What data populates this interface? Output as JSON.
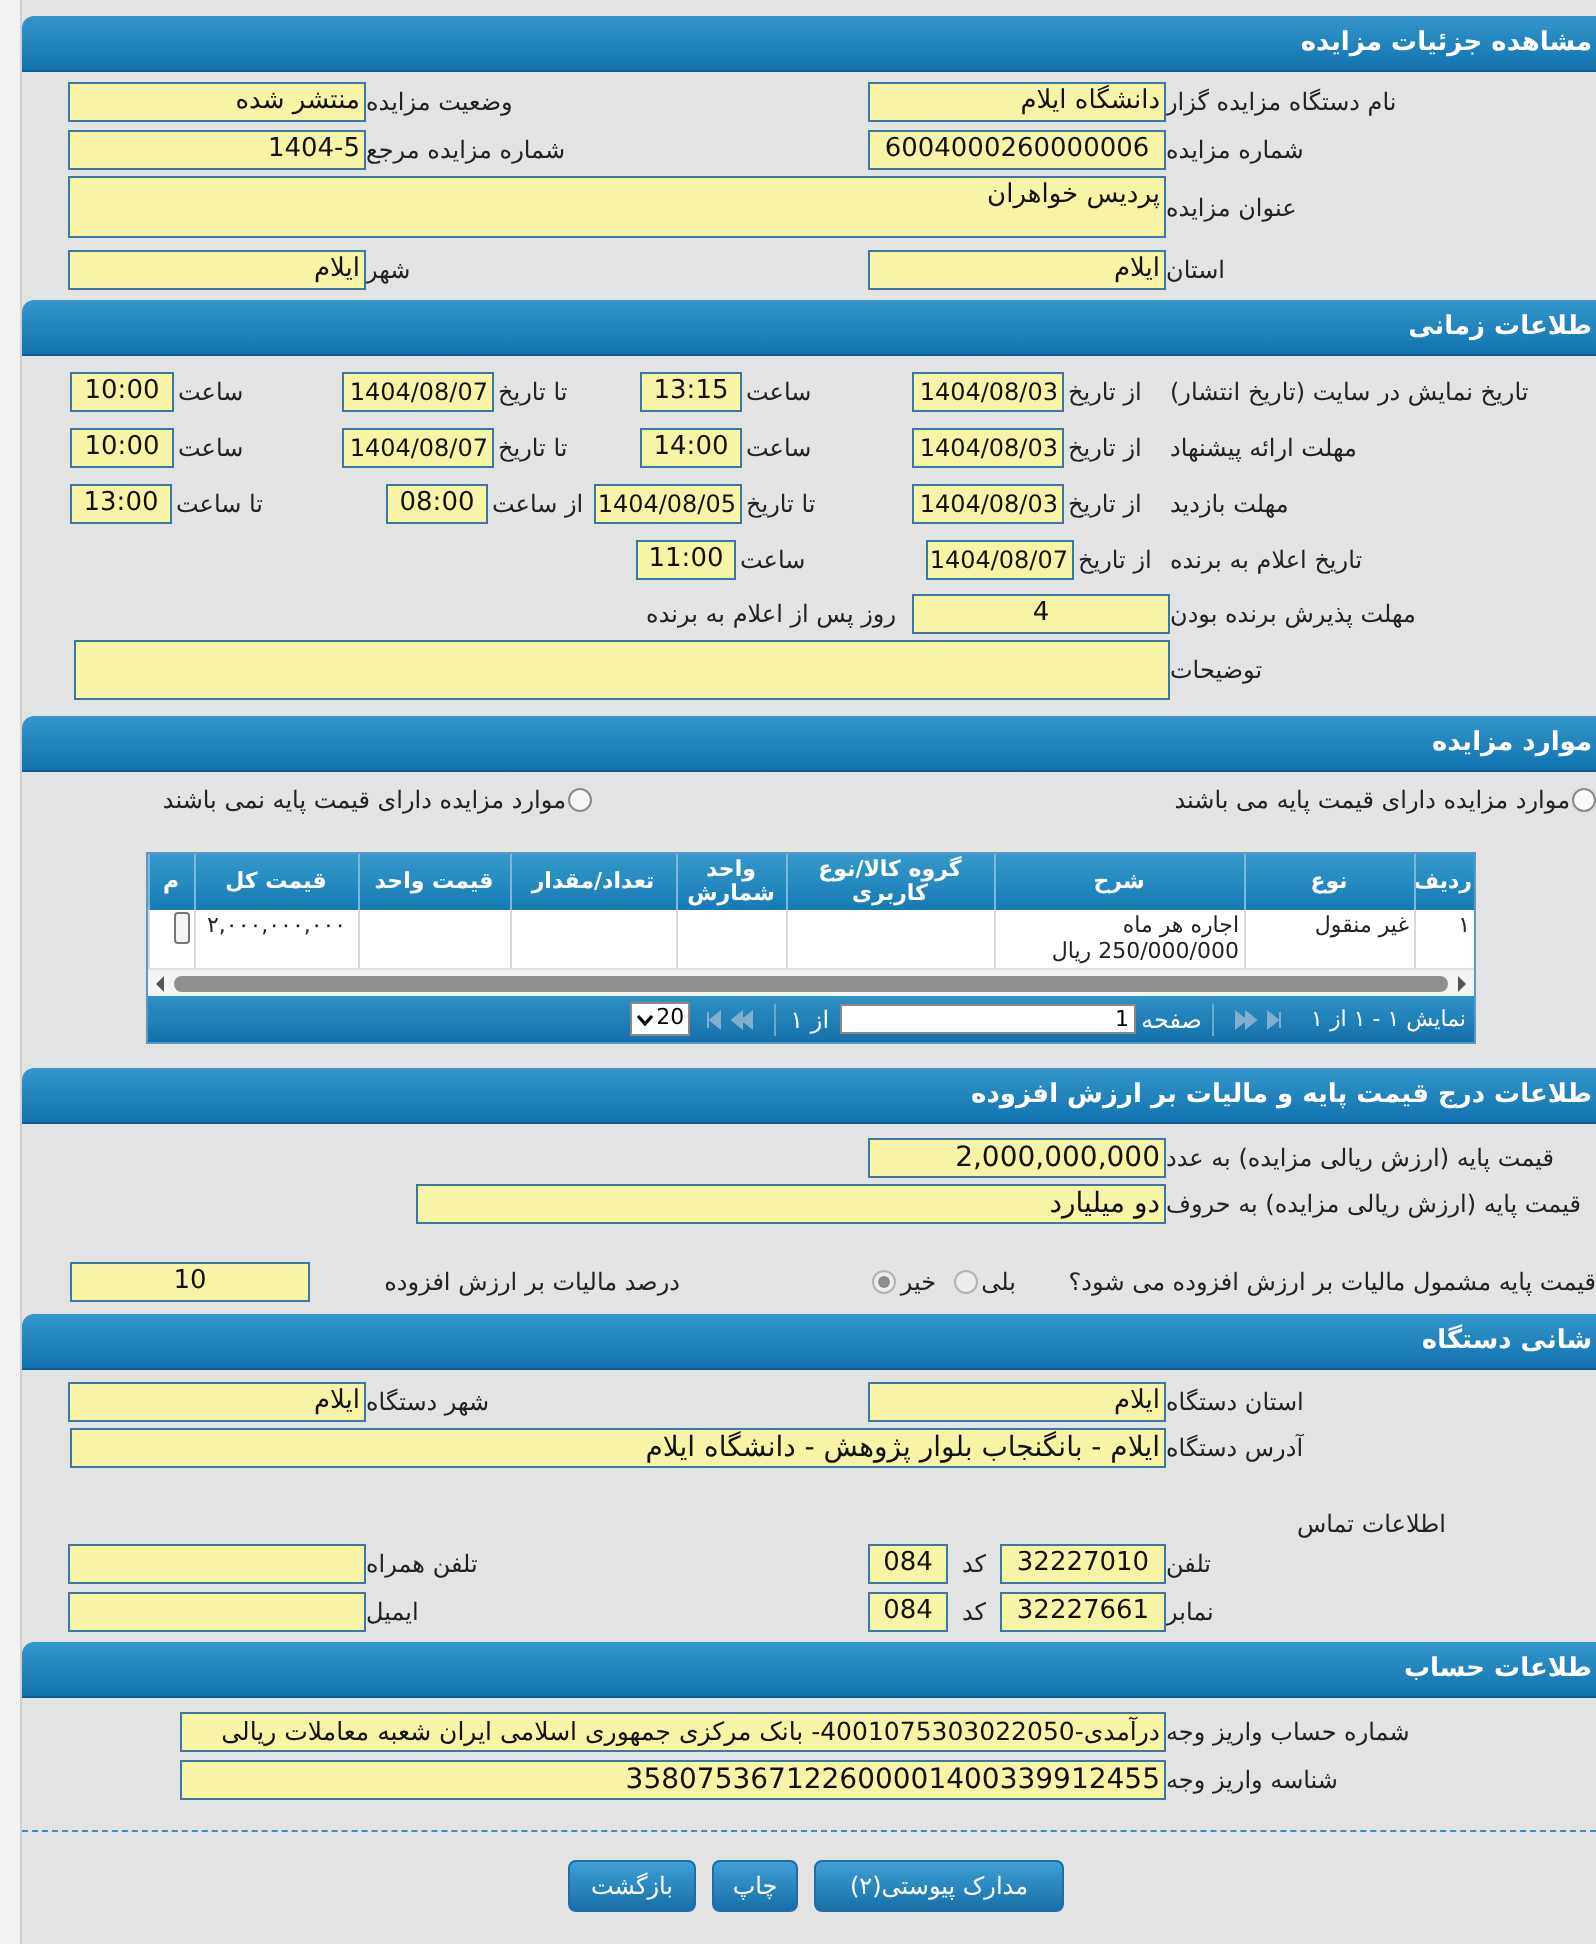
{
  "details": {
    "title": "مشاهده جزئیات مزایده",
    "fields": [
      {
        "label": "نام دستگاه مزایده گزار",
        "value": "دانشگاه ایلام"
      },
      {
        "label": "وضعیت مزایده",
        "value": "منتشر شده"
      },
      {
        "label": "شماره مزایده",
        "value": "6004000260000006"
      },
      {
        "label": "شماره مزایده مرجع",
        "value": "1404-5"
      },
      {
        "label": "عنوان مزایده",
        "value": "پردیس خواهران"
      },
      {
        "label": "استان",
        "value": "ایلام"
      },
      {
        "label": "شهر",
        "value": "ایلام"
      }
    ]
  },
  "timing": {
    "title": "طلاعات زمانی",
    "rows": [
      {
        "label": "تاریخ نمایش در سایت (تاریخ انتشار)",
        "parts": [
          {
            "label": "از تاریخ",
            "value": "1404/08/03"
          },
          {
            "label": "ساعت",
            "value": "13:15"
          },
          {
            "label": "تا تاریخ",
            "value": "1404/08/07"
          },
          {
            "label": "ساعت",
            "value": "10:00"
          }
        ]
      },
      {
        "label": "مهلت ارائه پیشنهاد",
        "parts": [
          {
            "label": "از تاریخ",
            "value": "1404/08/03"
          },
          {
            "label": "ساعت",
            "value": "14:00"
          },
          {
            "label": "تا تاریخ",
            "value": "1404/08/07"
          },
          {
            "label": "ساعت",
            "value": "10:00"
          }
        ]
      },
      {
        "label": "مهلت بازدید",
        "parts": [
          {
            "label": "از تاریخ",
            "value": "1404/08/03"
          },
          {
            "label": "تا تاریخ",
            "value": "1404/08/05"
          },
          {
            "label": "از ساعت",
            "value": "08:00"
          },
          {
            "label": "تا ساعت",
            "value": "13:00"
          }
        ]
      },
      {
        "label": "تاریخ اعلام به برنده",
        "parts": [
          {
            "label": "از تاریخ",
            "value": "1404/08/07"
          },
          {
            "label": "ساعت",
            "value": "11:00"
          }
        ]
      }
    ],
    "acceptance": {
      "label": "مهلت پذیرش برنده بودن",
      "value": "4",
      "suffix": "روز پس از اعلام به برنده"
    },
    "notes_label": "توضیحات"
  },
  "items": {
    "title": "موارد مزایده",
    "options": [
      {
        "label": "موارد مزایده دارای قیمت پایه می باشند",
        "selected": false
      },
      {
        "label": "موارد مزایده دارای قیمت پایه نمی باشند",
        "selected": false
      }
    ],
    "table": {
      "columns": [
        "ردیف",
        "نوع",
        "شرح",
        "گروه کالا/نوع کاربری",
        "واحد شمارش",
        "تعداد/مقدار",
        "قیمت واحد",
        "قیمت کل",
        "م"
      ],
      "rows": [
        {
          "row_no": "۱",
          "type": "غیر منقول",
          "description": "اجاره هر ماه 250/000/000 ریال",
          "total_price": "۲,۰۰۰,۰۰۰,۰۰۰"
        }
      ]
    },
    "pager": {
      "summary": "نمایش ۱ - ۱ از ۱",
      "page_label": "صفحه",
      "page": "1",
      "page_count": "از ۱",
      "page_size": "20"
    }
  },
  "pricing": {
    "title": "طلاعات درج قیمت پایه و مالیات بر ارزش افزوده",
    "fields": [
      {
        "label": "قیمت پایه (ارزش ریالی مزایده) به عدد",
        "value": "2,000,000,000"
      },
      {
        "label": "قیمت پایه (ارزش ریالی مزایده) به حروف",
        "value": "دو میلیارد"
      }
    ],
    "tax_question": "قیمت پایه مشمول مالیات بر ارزش افزوده می شود؟",
    "tax_options": [
      {
        "label": "بلی",
        "selected": false,
        "disabled": true
      },
      {
        "label": "خیر",
        "selected": true,
        "disabled": true
      }
    ],
    "tax_rate": {
      "label": "درصد مالیات بر ارزش افزوده",
      "value": "10"
    }
  },
  "address": {
    "title": "شانی دستگاه",
    "fields": [
      {
        "label": "استان دستگاه",
        "value": "ایلام"
      },
      {
        "label": "شهر دستگاه",
        "value": "ایلام"
      },
      {
        "label": "آدرس دستگاه",
        "value": "ایلام - بانگنجاب بلوار پژوهش - دانشگاه ایلام"
      }
    ],
    "contact_title": "اطلاعات تماس",
    "phones": [
      {
        "label": "تلفن",
        "number": "32227010",
        "code_label": "کد",
        "code": "084",
        "other_label": "تلفن همراه"
      },
      {
        "label": "نمابر",
        "number": "32227661",
        "code_label": "کد",
        "code": "084",
        "other_label": "ایمیل"
      }
    ]
  },
  "account": {
    "title": "طلاعات حساب",
    "fields": [
      {
        "label": "شماره حساب واریز وجه",
        "value": "درآمدی-4001075303022050- بانک مرکزی جمهوری اسلامی ایران شعبه معاملات ریالی"
      },
      {
        "label": "شناسه واریز وجه",
        "value": "358075367122600001400339912455"
      }
    ]
  },
  "buttons": [
    "مدارک پیوستی(۲)",
    "چاپ",
    "بازگشت"
  ]
}
